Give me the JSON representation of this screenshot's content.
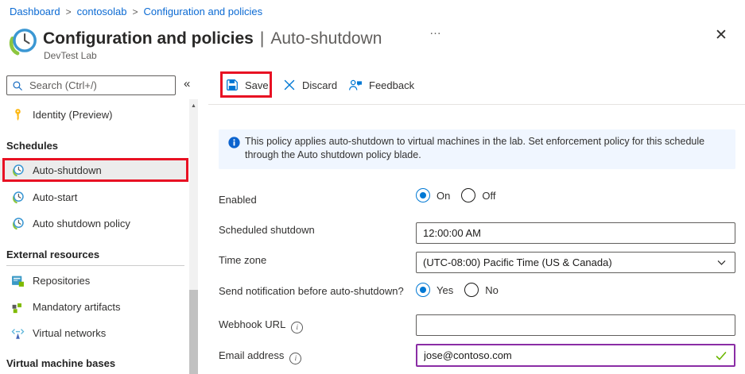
{
  "breadcrumb": {
    "separator": ">",
    "items": [
      "Dashboard",
      "contosolab",
      "Configuration and policies"
    ]
  },
  "header": {
    "title": "Configuration and policies",
    "divider": "|",
    "blade": "Auto-shutdown",
    "subtitle": "DevTest Lab",
    "more": "…",
    "close": "✕"
  },
  "sidebar": {
    "search_placeholder": "Search (Ctrl+/)",
    "collapse": "«",
    "scroll_up": "▲",
    "items": [
      {
        "label": "Identity (Preview)",
        "icon": "key-icon"
      },
      {
        "label": "Schedules",
        "type": "section-header"
      },
      {
        "label": "Auto-shutdown",
        "icon": "clock-icon",
        "selected": true,
        "highlighted": true
      },
      {
        "label": "Auto-start",
        "icon": "clock-icon"
      },
      {
        "label": "Auto shutdown policy",
        "icon": "clock-icon"
      },
      {
        "label": "External resources",
        "type": "section-header"
      },
      {
        "label": "Repositories",
        "icon": "repositories-icon"
      },
      {
        "label": "Mandatory artifacts",
        "icon": "artifacts-icon"
      },
      {
        "label": "Virtual networks",
        "icon": "virtual-network-icon"
      },
      {
        "label": "Virtual machine bases",
        "type": "section-header"
      }
    ]
  },
  "toolbar": {
    "save": "Save",
    "discard": "Discard",
    "feedback": "Feedback"
  },
  "banner": {
    "text": "This policy applies auto-shutdown to virtual machines in the lab. Set enforcement policy for this schedule through the Auto shutdown policy blade."
  },
  "form": {
    "enabled": {
      "label": "Enabled",
      "options": [
        "On",
        "Off"
      ],
      "selected": "On"
    },
    "scheduled_shutdown": {
      "label": "Scheduled shutdown",
      "value": "12:00:00 AM"
    },
    "time_zone": {
      "label": "Time zone",
      "value": "(UTC-08:00) Pacific Time (US & Canada)"
    },
    "send_notification": {
      "label": "Send notification before auto-shutdown?",
      "options": [
        "Yes",
        "No"
      ],
      "selected": "Yes"
    },
    "webhook_url": {
      "label": "Webhook URL",
      "value": "",
      "info": "i"
    },
    "email_address": {
      "label": "Email address",
      "value": "jose@contoso.com",
      "valid": true,
      "info": "i"
    }
  },
  "icons": {
    "devtest-lab-icon": "clock-with-green-swoosh",
    "search-icon": "magnifier",
    "save-icon": "floppy-disk",
    "discard-icon": "x-cross",
    "feedback-icon": "person-with-speech",
    "info-icon": "blue-filled-i-circle",
    "chevron-down-icon": "v",
    "check-icon": "green-checkmark"
  },
  "colors": {
    "link_blue": "#0b6ad3",
    "toolbar_icon_blue": "#0078d4",
    "annotation_red": "#e81123",
    "banner_bg": "#f0f6ff",
    "banner_icon_blue": "#0c63ce",
    "email_border_purple": "#8a2da5",
    "check_green": "#6bb700",
    "selected_row_bg": "#ececec"
  }
}
